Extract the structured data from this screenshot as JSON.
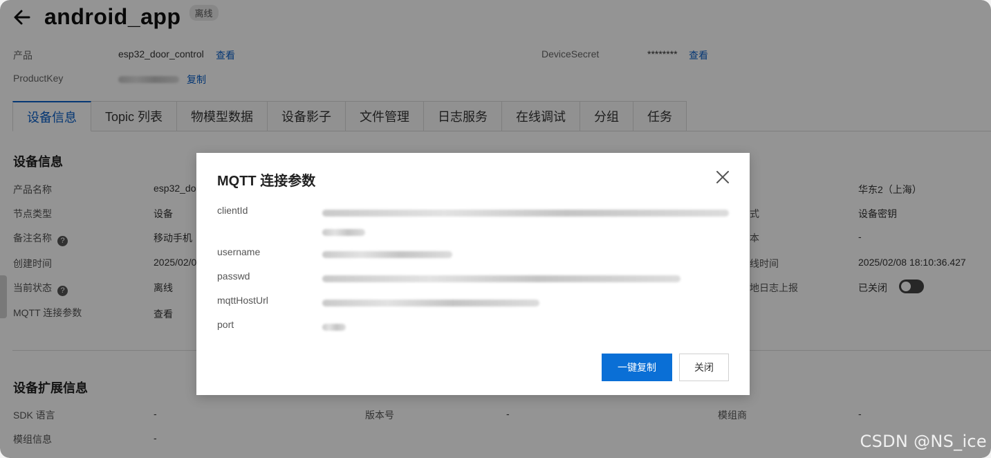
{
  "header": {
    "title": "android_app",
    "status": "离线"
  },
  "meta": {
    "product_label": "产品",
    "product_value": "esp32_door_control",
    "product_link": "查看",
    "productkey_label": "ProductKey",
    "productkey_copy": "复制",
    "secret_label": "DeviceSecret",
    "secret_value": "********",
    "secret_link": "查看"
  },
  "tabs": [
    {
      "label": "设备信息"
    },
    {
      "label": "Topic 列表"
    },
    {
      "label": "物模型数据"
    },
    {
      "label": "设备影子"
    },
    {
      "label": "文件管理"
    },
    {
      "label": "日志服务"
    },
    {
      "label": "在线调试"
    },
    {
      "label": "分组"
    },
    {
      "label": "任务"
    }
  ],
  "device_info": {
    "section_title": "设备信息",
    "left": [
      {
        "label": "产品名称",
        "value": "esp32_do"
      },
      {
        "label": "节点类型",
        "value": "设备"
      },
      {
        "label": "备注名称",
        "value": "移动手机"
      },
      {
        "label": "创建时间",
        "value": "2025/02/0"
      },
      {
        "label": "当前状态",
        "value": "离线"
      },
      {
        "label": "MQTT 连接参数",
        "value": "查看"
      }
    ],
    "right": [
      {
        "label": "",
        "value": "华东2（上海）"
      },
      {
        "label": "式",
        "value": "设备密钥"
      },
      {
        "label": "本",
        "value": "-"
      },
      {
        "label": "线时间",
        "value": "2025/02/08 18:10:36.427"
      },
      {
        "label": "地日志上报",
        "value": "已关闭"
      }
    ]
  },
  "extended_info": {
    "section_title": "设备扩展信息",
    "sdk_label": "SDK 语言",
    "sdk_value": "-",
    "version_label": "版本号",
    "version_value": "-",
    "vendor_label": "模组商",
    "vendor_value": "-",
    "module_label": "模组信息",
    "module_value": "-"
  },
  "modal": {
    "title": "MQTT 连接参数",
    "params": [
      {
        "label": "clientId"
      },
      {
        "label": "username"
      },
      {
        "label": "passwd"
      },
      {
        "label": "mqttHostUrl"
      },
      {
        "label": "port"
      }
    ],
    "copy_all": "一键复制",
    "close": "关闭"
  },
  "watermark": "CSDN @NS_ice",
  "colors": {
    "accent": "#0a6fd6",
    "link": "#0a5fc8"
  }
}
